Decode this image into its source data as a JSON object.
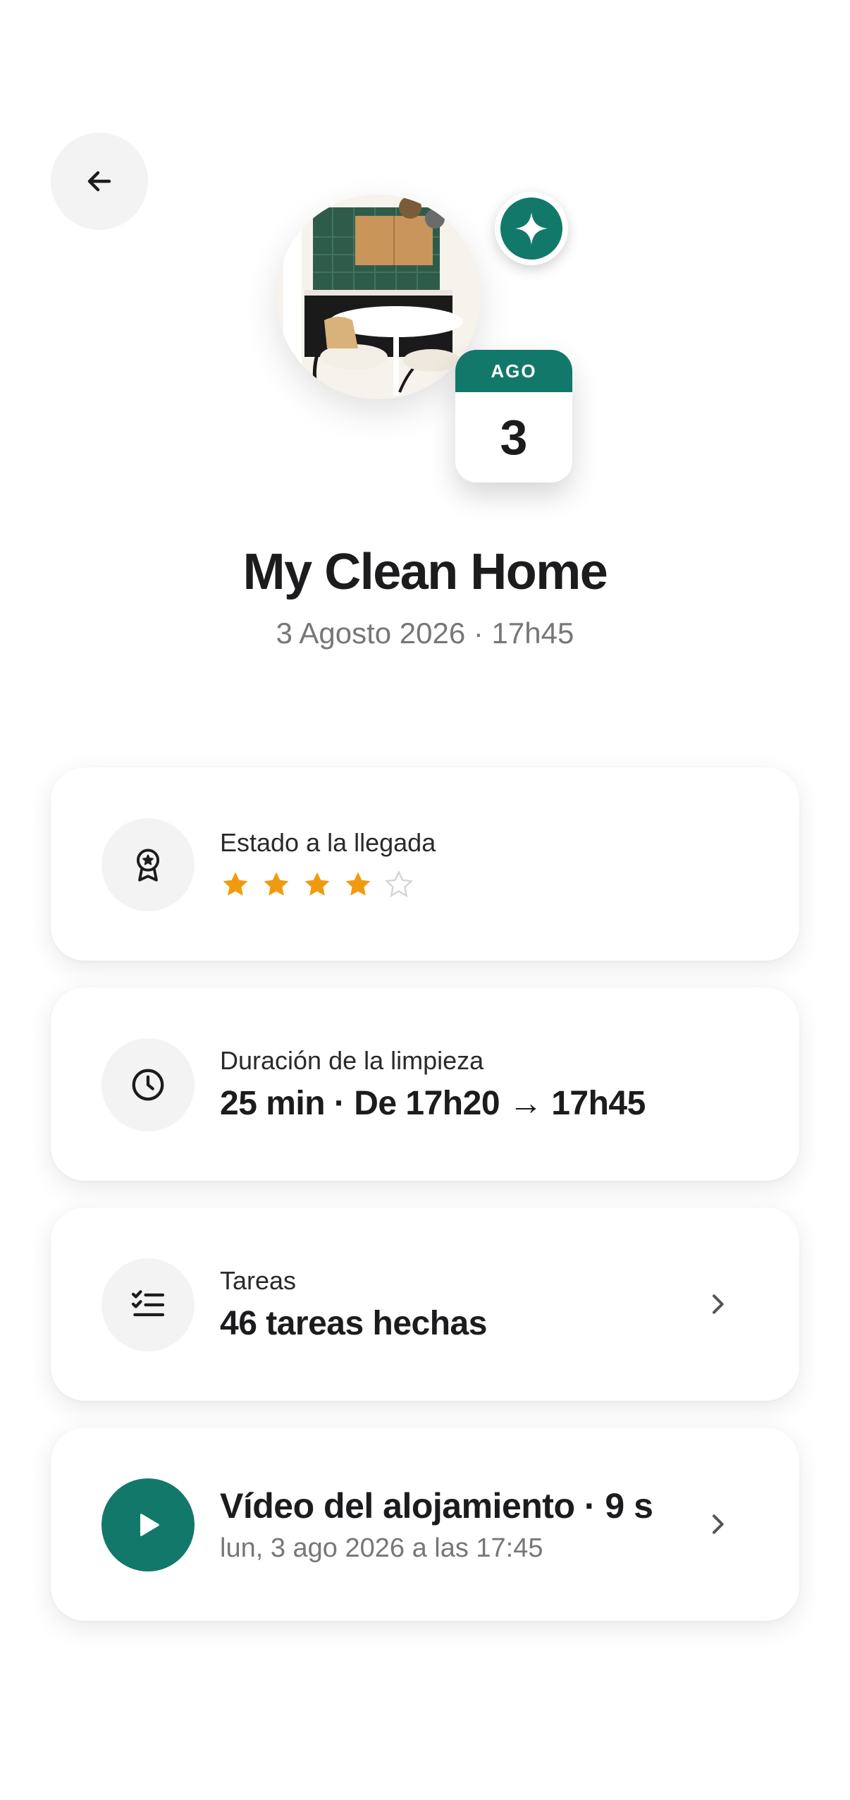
{
  "header": {
    "back_icon": "arrow-left-icon"
  },
  "hero": {
    "badge_icon": "sparkle-icon",
    "calendar_month": "AGO",
    "calendar_day": "3"
  },
  "title": "My Clean Home",
  "subtitle": "3 Agosto 2026 · 17h45",
  "cards": {
    "arrival": {
      "icon": "award-ribbon-icon",
      "label": "Estado a la llegada",
      "rating": 4,
      "rating_max": 5
    },
    "duration": {
      "icon": "clock-icon",
      "label": "Duración de la limpieza",
      "value": "25 min · De 17h20 → 17h45"
    },
    "tasks": {
      "icon": "checklist-icon",
      "label": "Tareas",
      "value": "46 tareas hechas"
    },
    "video": {
      "icon": "play-icon",
      "title": "Vídeo del alojamiento · 9 s",
      "subtitle": "lun, 3 ago 2026 a las 17:45"
    }
  },
  "colors": {
    "brand": "#12786a",
    "star": "#f29a0f",
    "star_empty": "#d4d4d4"
  }
}
